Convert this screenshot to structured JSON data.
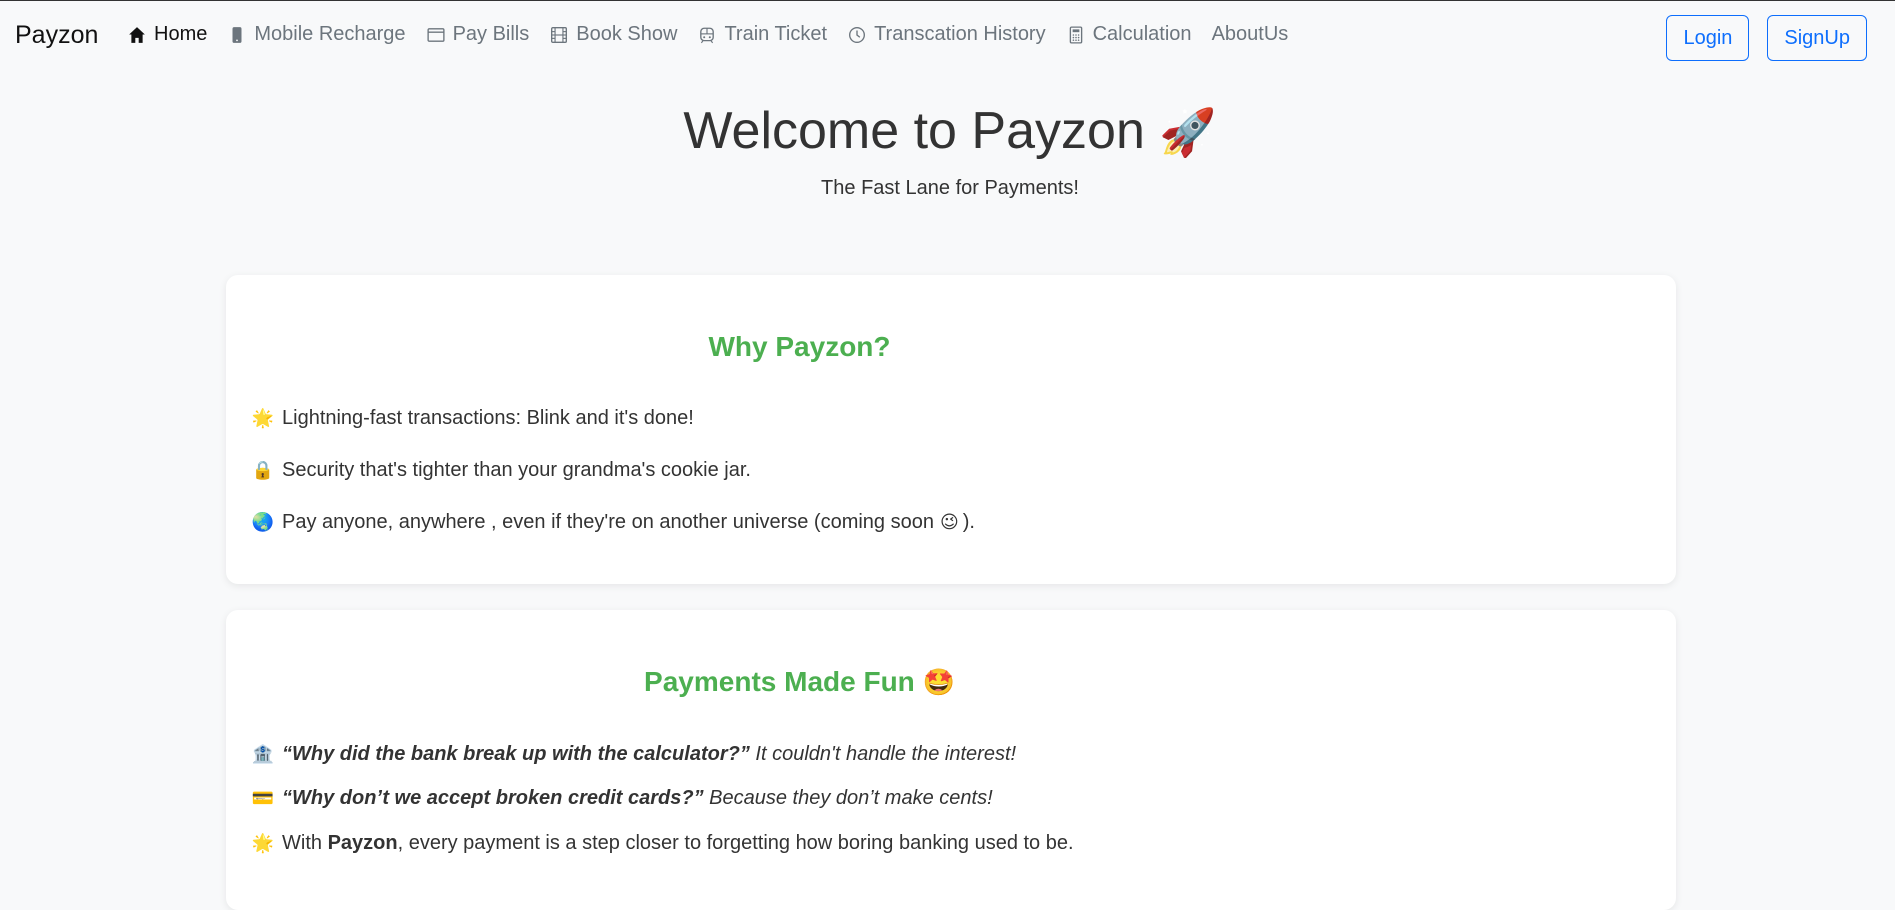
{
  "brand": "Payzon",
  "nav": [
    {
      "label": "Home",
      "icon": "home-icon",
      "active": true
    },
    {
      "label": "Mobile Recharge",
      "icon": "mobile-icon"
    },
    {
      "label": "Pay Bills",
      "icon": "window-icon"
    },
    {
      "label": "Book Show",
      "icon": "film-icon"
    },
    {
      "label": "Train Ticket",
      "icon": "train-icon"
    },
    {
      "label": "Transcation History",
      "icon": "clock-icon"
    },
    {
      "label": "Calculation",
      "icon": "calculator-icon"
    },
    {
      "label": "AboutUs",
      "icon": ""
    }
  ],
  "auth": {
    "login": "Login",
    "signup": "SignUp"
  },
  "hero": {
    "title": "Welcome to Payzon",
    "title_emoji": "🚀",
    "subtitle": "The Fast Lane for Payments!"
  },
  "why": {
    "heading": "Why Payzon?",
    "items": [
      {
        "emoji": "🌟",
        "text": "Lightning-fast transactions: Blink and it's done!"
      },
      {
        "emoji": "🔒",
        "text": "Security that's tighter than your grandma's cookie jar."
      },
      {
        "emoji": "🌏",
        "text": "Pay anyone, anywhere , even if they're on another universe (coming soon",
        "suffix_emoji": "😉",
        "suffix": ")."
      }
    ]
  },
  "fun": {
    "heading": "Payments Made Fun",
    "heading_emoji": "🤩",
    "items": [
      {
        "emoji": "🏦",
        "question": "“Why did the bank break up with the calculator?”",
        "answer": "It couldn't handle the interest!"
      },
      {
        "emoji": "💳",
        "question": "“Why don’t we accept broken credit cards?”",
        "answer": "Because they don’t make cents!"
      },
      {
        "emoji": "🌟",
        "pre": "With",
        "bold": "Payzon",
        "post": ", every payment is a step closer to forgetting how boring banking used to be."
      }
    ]
  },
  "colors": {
    "accent_green": "#4caf50",
    "primary_blue": "#0d6efd",
    "background": "#f8f9fa"
  }
}
